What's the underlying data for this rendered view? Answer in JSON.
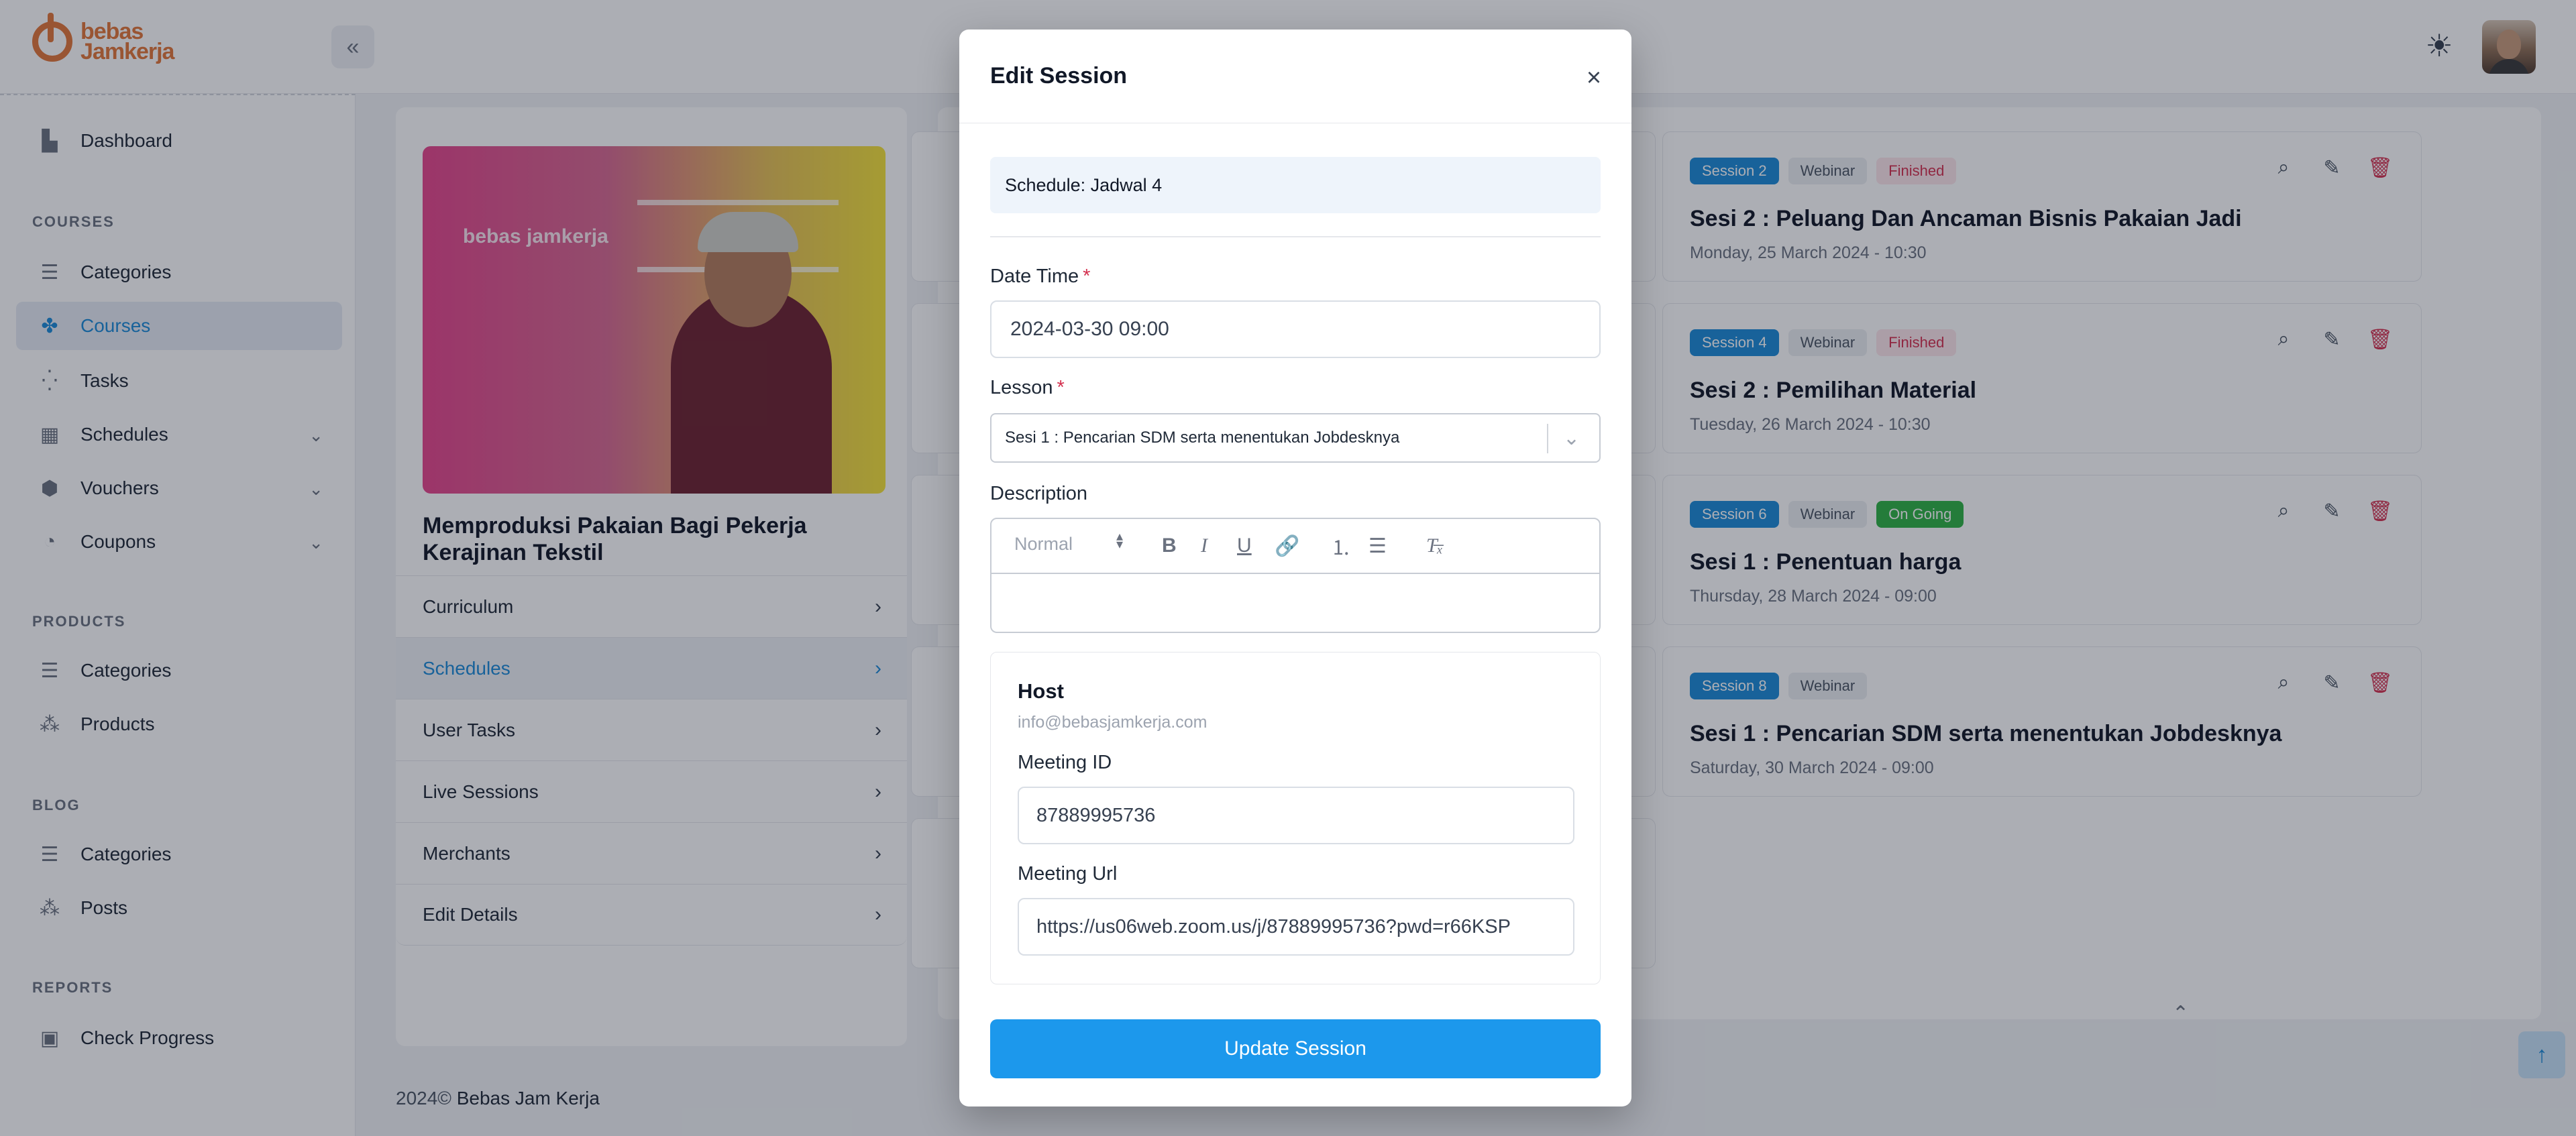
{
  "brand": {
    "name_line1": "bebas",
    "name_line2": "Jamkerja"
  },
  "sidebar": {
    "items": [
      {
        "label": "Dashboard"
      },
      {
        "label": "Categories"
      },
      {
        "label": "Courses"
      },
      {
        "label": "Tasks"
      },
      {
        "label": "Schedules"
      },
      {
        "label": "Vouchers"
      },
      {
        "label": "Coupons"
      },
      {
        "label": "Categories"
      },
      {
        "label": "Products"
      },
      {
        "label": "Categories"
      },
      {
        "label": "Posts"
      },
      {
        "label": "Check Progress"
      }
    ],
    "headings": {
      "courses": "COURSES",
      "products": "PRODUCTS",
      "blog": "BLOG",
      "reports": "REPORTS"
    }
  },
  "course": {
    "image_watermark": "bebas jamkerja",
    "title": "Memproduksi Pakaian Bagi Pekerja Kerajinan Tekstil",
    "nav": [
      "Curriculum",
      "Schedules",
      "User Tasks",
      "Live Sessions",
      "Merchants",
      "Edit Details"
    ]
  },
  "sessions": [
    {
      "badge": "Session 2",
      "type": "Webinar",
      "status": "Finished",
      "title": "Sesi 2 : Peluang Dan Ancaman Bisnis Pakaian Jadi",
      "date": "Monday, 25 March 2024 - 10:30"
    },
    {
      "badge": "Session 4",
      "type": "Webinar",
      "status": "Finished",
      "title": "Sesi 2 : Pemilihan Material",
      "date": "Tuesday, 26 March 2024 - 10:30"
    },
    {
      "badge": "Session 6",
      "type": "Webinar",
      "status": "On Going",
      "title": "Sesi 1 : Penentuan harga",
      "date": "Thursday, 28 March 2024 - 09:00"
    },
    {
      "badge": "Session 8",
      "type": "Webinar",
      "status": "",
      "title": "Sesi 1 : Pencarian SDM serta menentukan Jobdesknya",
      "date": "Saturday, 30 March 2024 - 09:00"
    }
  ],
  "footer": {
    "year": "2024©",
    "company": "Bebas Jam Kerja"
  },
  "modal": {
    "title": "Edit Session",
    "schedule": "Schedule: Jadwal 4",
    "date_time_label": "Date Time",
    "date_time_value": "2024-03-30 09:00",
    "lesson_label": "Lesson",
    "lesson_value": "Sesi 1 : Pencarian SDM serta menentukan Jobdesknya",
    "description_label": "Description",
    "editor_format": "Normal",
    "required_mark": "*",
    "host": {
      "title": "Host",
      "email": "info@bebasjamkerja.com",
      "meeting_id_label": "Meeting ID",
      "meeting_id_value": "87889995736",
      "meeting_url_label": "Meeting Url",
      "meeting_url_value": "https://us06web.zoom.us/j/87889995736?pwd=r66KSP"
    },
    "submit_label": "Update Session"
  },
  "icons": {
    "collapse": "double-chevron-left-icon",
    "theme": "sun-icon",
    "close": "close-icon",
    "view": "magnifier-icon",
    "edit": "pencil-icon",
    "delete": "trash-icon"
  },
  "colors": {
    "primary": "#1c98ec",
    "accent_orange": "#e2773a",
    "danger": "#d4314f",
    "success": "#2fb344"
  }
}
